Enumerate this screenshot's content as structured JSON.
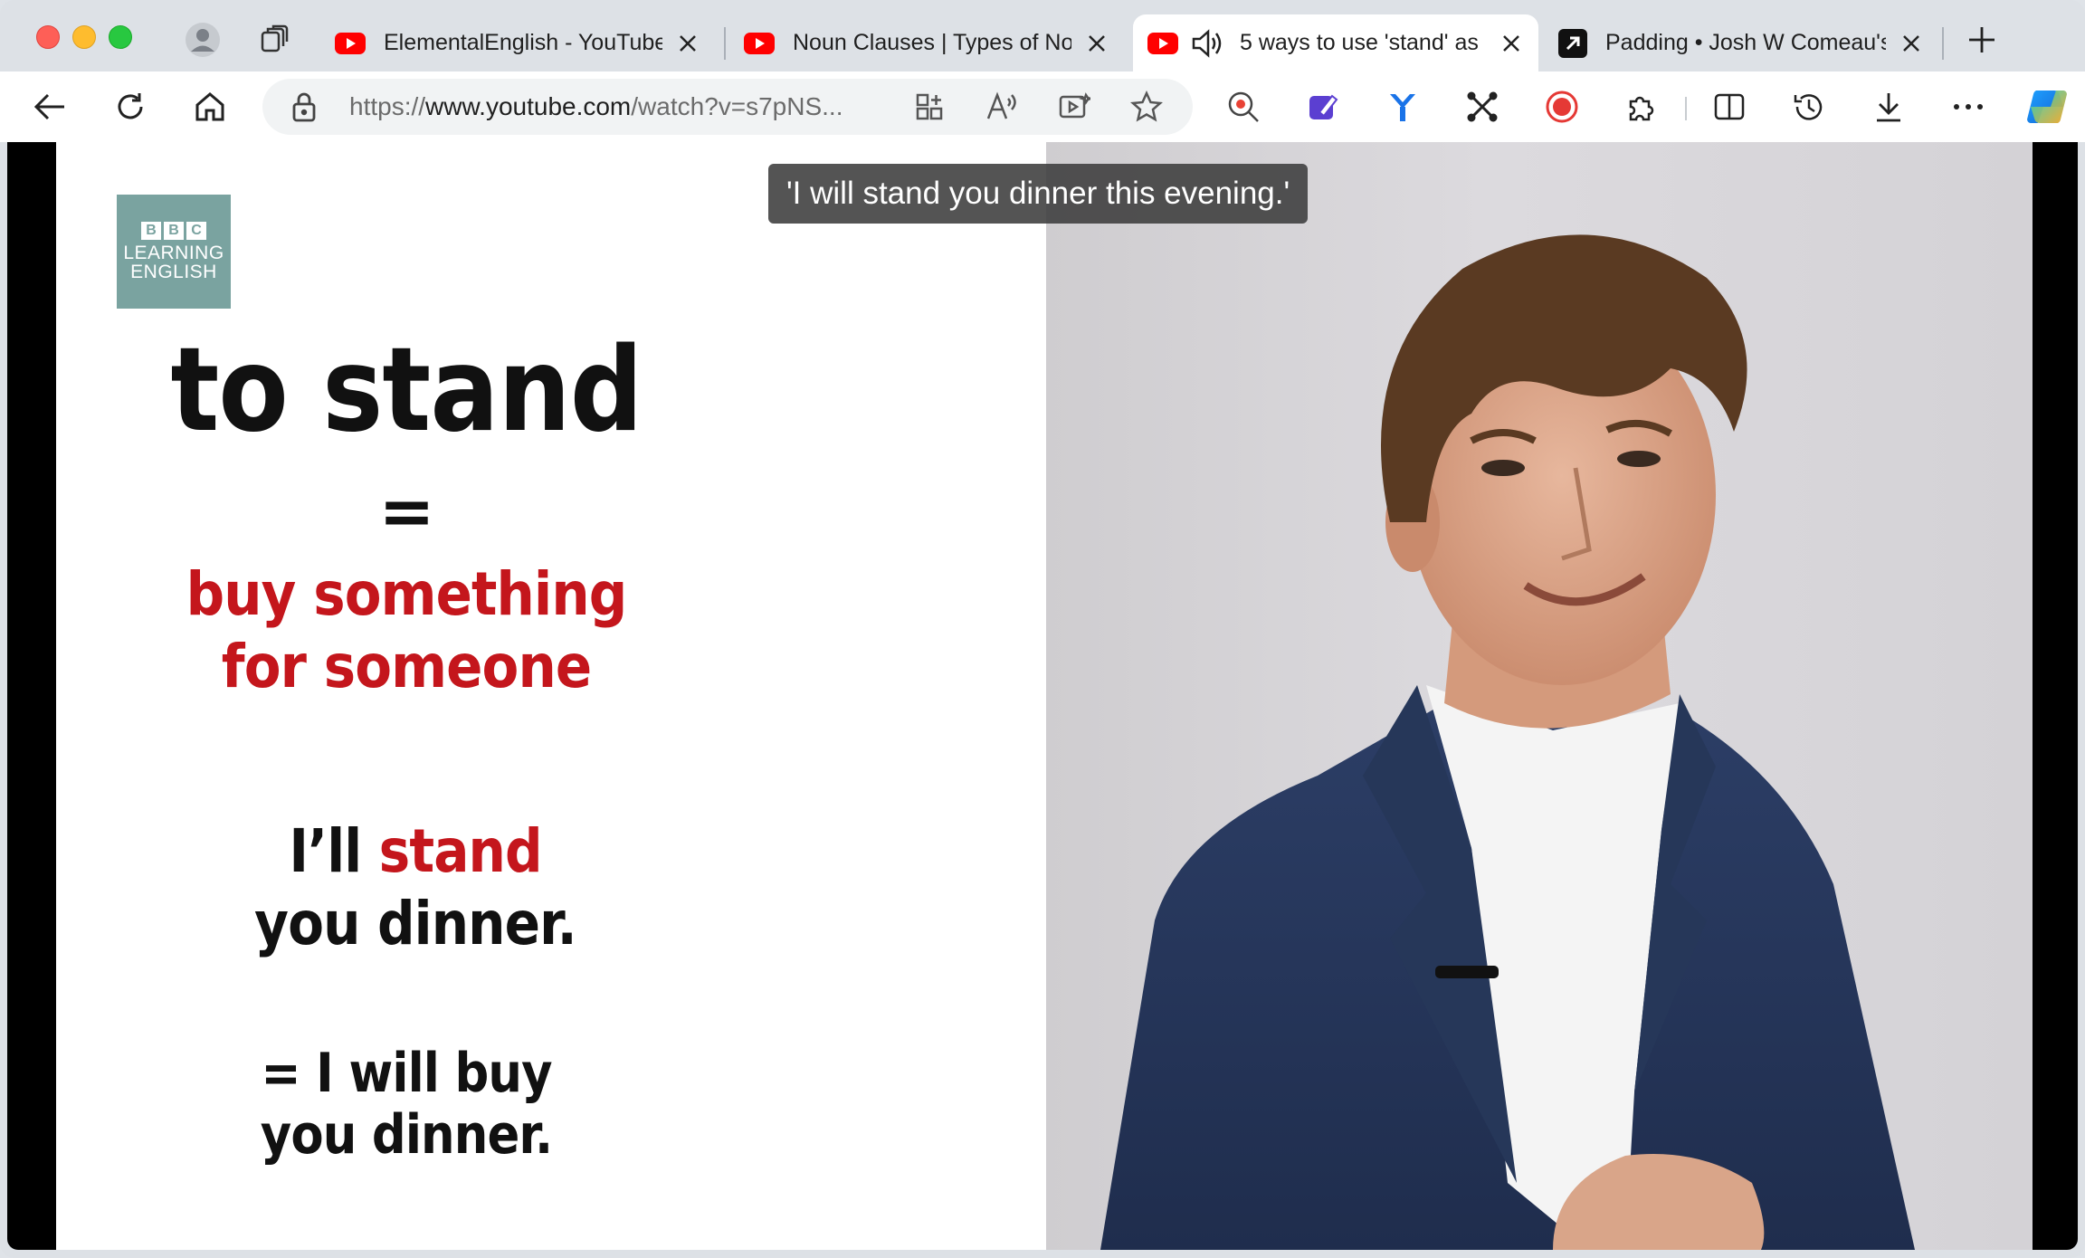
{
  "browser": {
    "tabs": [
      {
        "title": "ElementalEnglish - YouTube",
        "favicon": "youtube-icon",
        "active": false
      },
      {
        "title": "Noun Clauses | Types of Nou",
        "favicon": "youtube-icon",
        "active": false
      },
      {
        "title": "5 ways to use 'stand' as",
        "favicon": "youtube-icon",
        "active": true,
        "audio": true
      },
      {
        "title": "Padding • Josh W Comeau's",
        "favicon": "arrow-favicon-icon",
        "active": false
      }
    ],
    "url_prefix": "https://",
    "url_host": "www.youtube.com",
    "url_path": "/watch?v=s7pNS..."
  },
  "video": {
    "caption": "'I will stand you dinner this evening.'",
    "slide": {
      "logo_lines": [
        "B",
        "B",
        "C",
        "LEARNING",
        "ENGLISH"
      ],
      "heading": "to stand",
      "equals": "=",
      "definition_line1": "buy something",
      "definition_line2": "for someone",
      "example_prefix": "I’ll ",
      "example_highlight": "stand",
      "example_line2": "you dinner.",
      "meaning_line1": "= I will buy",
      "meaning_line2": "you dinner."
    }
  },
  "colors": {
    "accent_red": "#c4161c",
    "logo_teal": "#7aa3a0",
    "youtube_red": "#ff0000"
  }
}
